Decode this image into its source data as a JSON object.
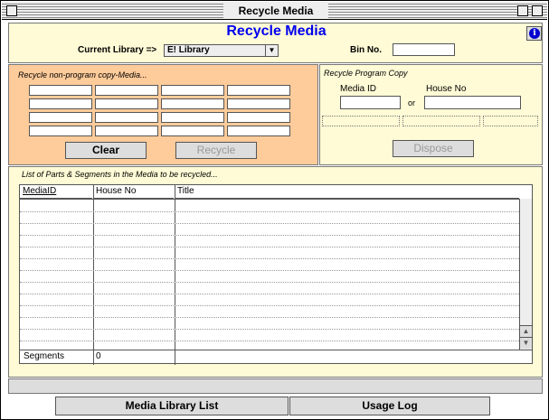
{
  "window": {
    "title": "Recycle Media"
  },
  "header": {
    "app_title": "Recycle Media",
    "library_label": "Current Library =>",
    "library_value": "E! Library",
    "bin_label": "Bin No.",
    "bin_value": "",
    "info_icon": "info-icon"
  },
  "left_panel": {
    "title": "Recycle non-program copy-Media...",
    "grid_values": [
      "",
      "",
      "",
      "",
      "",
      "",
      "",
      "",
      "",
      "",
      "",
      "",
      "",
      "",
      "",
      ""
    ],
    "clear_label": "Clear",
    "recycle_label": "Recycle"
  },
  "right_panel": {
    "title": "Recycle Program Copy",
    "media_id_label": "Media ID",
    "house_no_label": "House No",
    "or_label": "or",
    "media_id_value": "",
    "house_no_value": "",
    "dispose_label": "Dispose"
  },
  "list_panel": {
    "title": "List of Parts & Segments in the Media to be recycled...",
    "columns": [
      "MediaID",
      "House No",
      "Title"
    ],
    "rows": [],
    "segments_label": "Segments",
    "segments_value": "0"
  },
  "bottom": {
    "media_library_label": "Media Library List",
    "usage_log_label": "Usage Log"
  },
  "colors": {
    "accent_title": "#0000ee",
    "panel_cream": "#fffbd6",
    "panel_peach": "#fecb9a"
  }
}
